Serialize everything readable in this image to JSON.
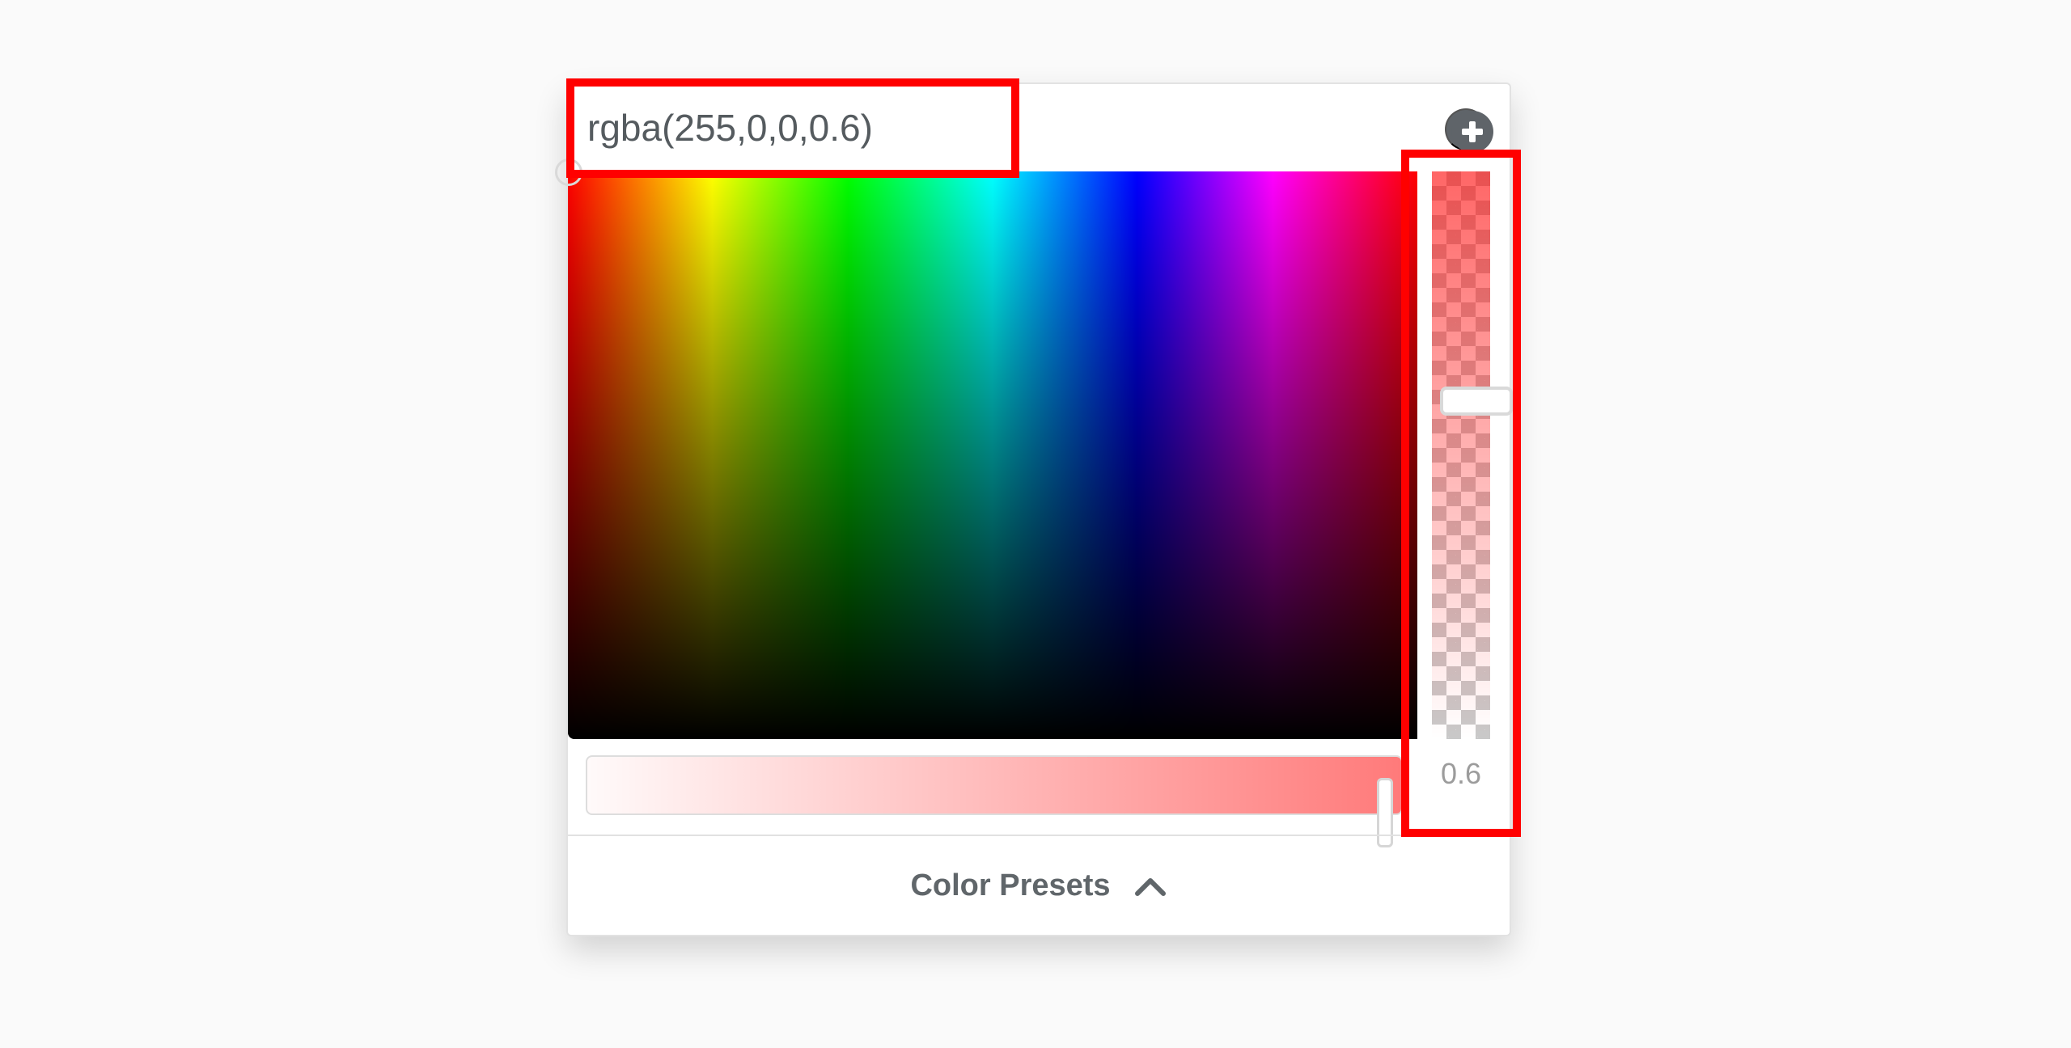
{
  "color_picker": {
    "value": "rgba(255,0,0,0.6)",
    "alpha_value": "0.6",
    "alpha_level": 0.6,
    "selected_color": "#ff0000",
    "presets_label": "Color Presets"
  },
  "icons": {
    "add": "plus-circle-icon",
    "presets_toggle": "chevron-up-icon"
  },
  "colors": {
    "annotation": "#ff0000",
    "text": "#555b5f",
    "background": "#fafafa"
  }
}
